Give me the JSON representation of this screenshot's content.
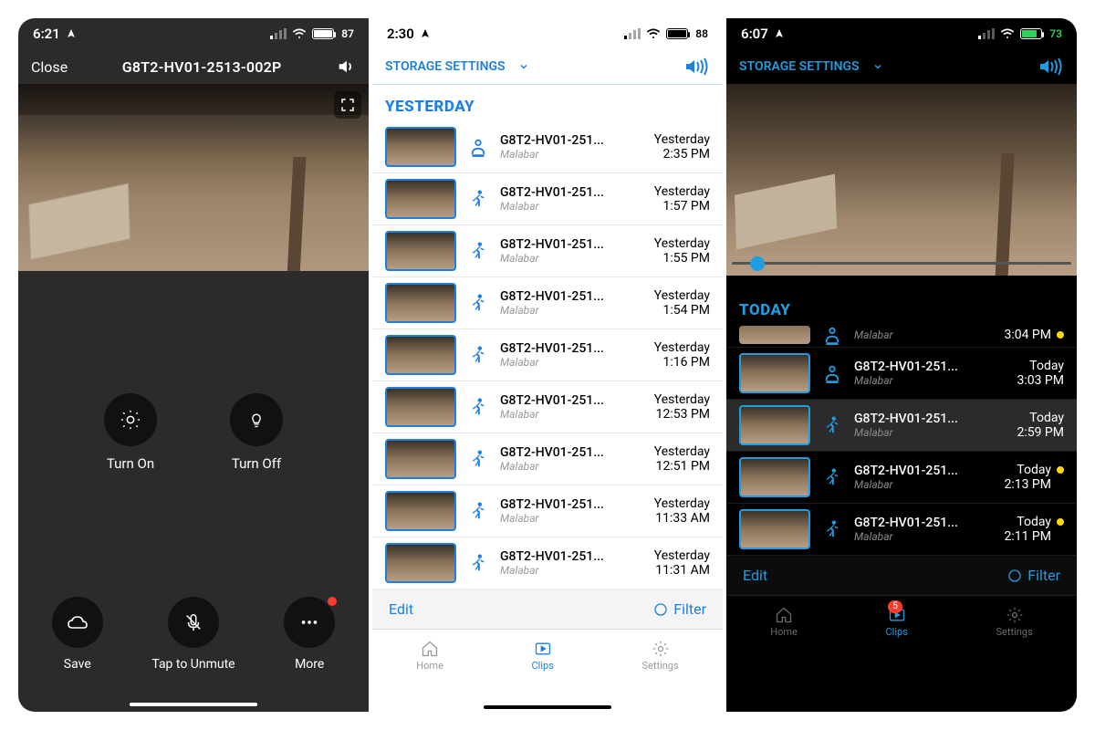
{
  "phone1": {
    "status": {
      "time": "6:21",
      "battery": "87"
    },
    "topbar": {
      "close": "Close",
      "title": "G8T2-HV01-2513-002P"
    },
    "midControls": {
      "turnOn": "Turn On",
      "turnOff": "Turn Off"
    },
    "bottom": {
      "save": "Save",
      "unmute": "Tap to Unmute",
      "more": "More"
    }
  },
  "phone2": {
    "status": {
      "time": "2:30",
      "battery": "88"
    },
    "header": {
      "storage": "STORAGE SETTINGS"
    },
    "section": "YESTERDAY",
    "clips": [
      {
        "name": "G8T2-HV01-251...",
        "loc": "Malabar",
        "day": "Yesterday",
        "time": "2:35 PM",
        "icon": "person"
      },
      {
        "name": "G8T2-HV01-251...",
        "loc": "Malabar",
        "day": "Yesterday",
        "time": "1:57 PM",
        "icon": "motion"
      },
      {
        "name": "G8T2-HV01-251...",
        "loc": "Malabar",
        "day": "Yesterday",
        "time": "1:55 PM",
        "icon": "motion"
      },
      {
        "name": "G8T2-HV01-251...",
        "loc": "Malabar",
        "day": "Yesterday",
        "time": "1:54 PM",
        "icon": "motion"
      },
      {
        "name": "G8T2-HV01-251...",
        "loc": "Malabar",
        "day": "Yesterday",
        "time": "1:16 PM",
        "icon": "motion"
      },
      {
        "name": "G8T2-HV01-251...",
        "loc": "Malabar",
        "day": "Yesterday",
        "time": "12:53 PM",
        "icon": "motion"
      },
      {
        "name": "G8T2-HV01-251...",
        "loc": "Malabar",
        "day": "Yesterday",
        "time": "12:51 PM",
        "icon": "motion"
      },
      {
        "name": "G8T2-HV01-251...",
        "loc": "Malabar",
        "day": "Yesterday",
        "time": "11:33 AM",
        "icon": "motion"
      },
      {
        "name": "G8T2-HV01-251...",
        "loc": "Malabar",
        "day": "Yesterday",
        "time": "11:31 AM",
        "icon": "motion"
      }
    ],
    "toolbar": {
      "edit": "Edit",
      "filter": "Filter"
    },
    "tabs": {
      "home": "Home",
      "clips": "Clips",
      "settings": "Settings"
    }
  },
  "phone3": {
    "status": {
      "time": "6:07",
      "battery": "73"
    },
    "header": {
      "storage": "STORAGE SETTINGS"
    },
    "section": "TODAY",
    "clips": [
      {
        "name": "",
        "loc": "Malabar",
        "day": "",
        "time": "3:04 PM",
        "icon": "person",
        "partial": true,
        "dot": true
      },
      {
        "name": "G8T2-HV01-251...",
        "loc": "Malabar",
        "day": "Today",
        "time": "3:03 PM",
        "icon": "person",
        "dot": false
      },
      {
        "name": "G8T2-HV01-251...",
        "loc": "Malabar",
        "day": "Today",
        "time": "2:59 PM",
        "icon": "motion",
        "selected": true
      },
      {
        "name": "G8T2-HV01-251...",
        "loc": "Malabar",
        "day": "Today",
        "time": "2:13 PM",
        "icon": "motion",
        "dot": true
      },
      {
        "name": "G8T2-HV01-251...",
        "loc": "Malabar",
        "day": "Today",
        "time": "2:11 PM",
        "icon": "motion",
        "dot": true
      }
    ],
    "toolbar": {
      "edit": "Edit",
      "filter": "Filter"
    },
    "tabs": {
      "home": "Home",
      "clips": "Clips",
      "settings": "Settings",
      "badge": "5"
    }
  }
}
